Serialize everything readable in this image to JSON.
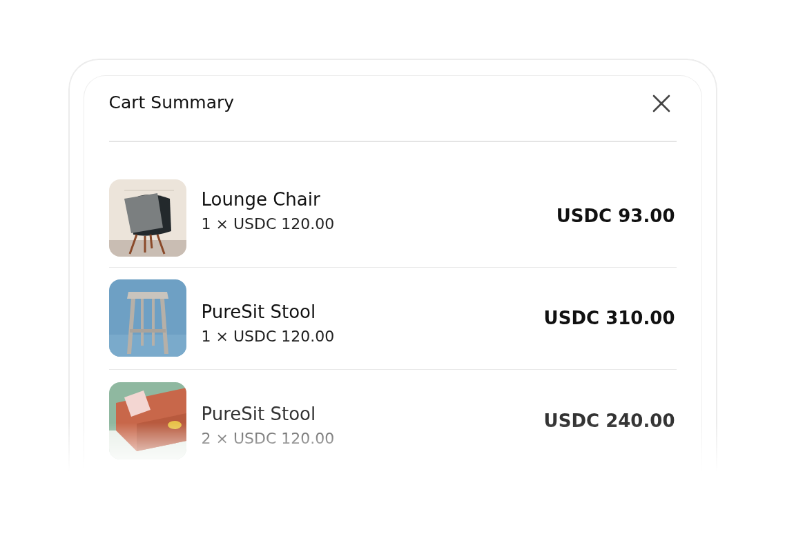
{
  "title": "Cart Summary",
  "items": [
    {
      "name": "Lounge Chair",
      "quantity_price": "1 × USDC 120.00",
      "total": "USDC 93.00",
      "kind": "chair"
    },
    {
      "name": "PureSit Stool",
      "quantity_price": "1 × USDC 120.00",
      "total": "USDC 310.00",
      "kind": "stool"
    },
    {
      "name": "PureSit Stool",
      "quantity_price": "2 × USDC 120.00",
      "total": "USDC 240.00",
      "kind": "sofa"
    }
  ]
}
